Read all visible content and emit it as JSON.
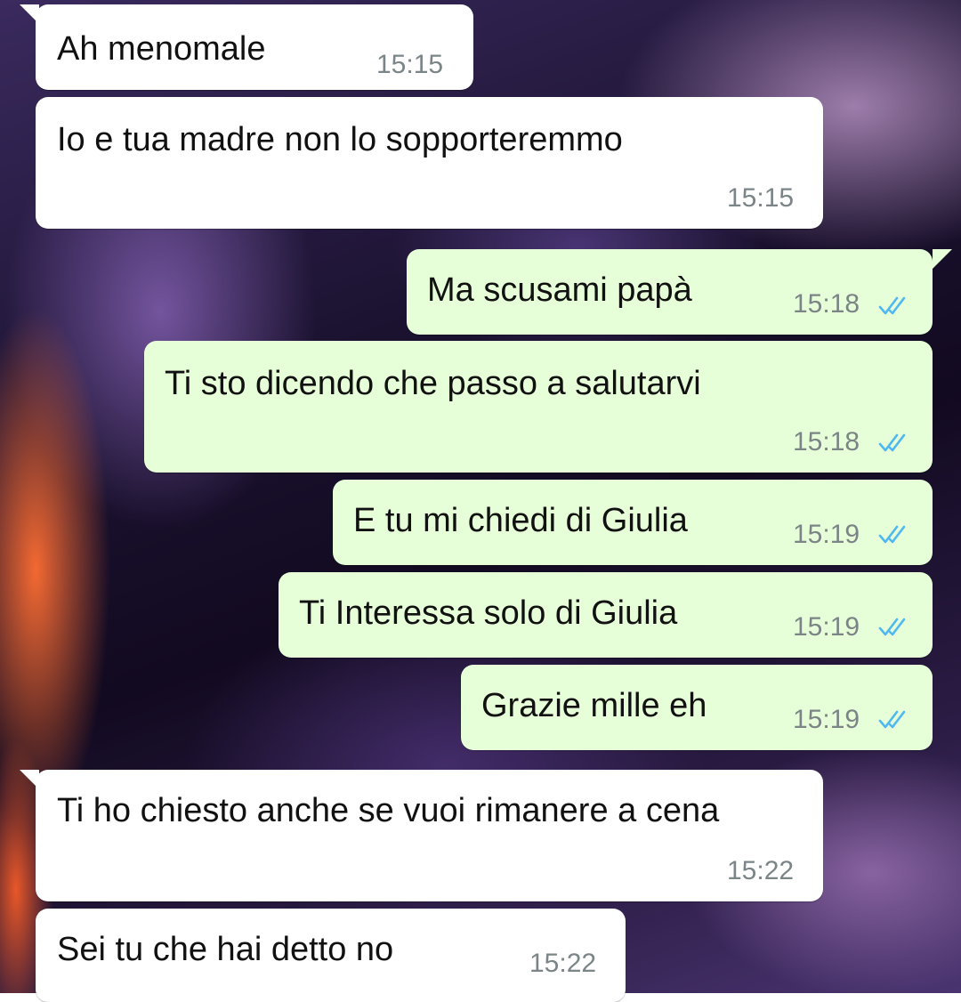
{
  "chat": {
    "messages": [
      {
        "direction": "incoming",
        "text": "Ah menomale",
        "time": "15:15"
      },
      {
        "direction": "incoming",
        "text": "Io e tua madre non lo sopporteremmo",
        "time": "15:15"
      },
      {
        "direction": "outgoing",
        "text": "Ma scusami papà",
        "time": "15:18",
        "status": "read-double-check"
      },
      {
        "direction": "outgoing",
        "text": "Ti sto dicendo che passo a salutarvi",
        "time": "15:18",
        "status": "read-double-check"
      },
      {
        "direction": "outgoing",
        "text": "E tu mi chiedi di Giulia",
        "time": "15:19",
        "status": "read-double-check"
      },
      {
        "direction": "outgoing",
        "text": "Ti Interessa solo di Giulia",
        "time": "15:19",
        "status": "read-double-check"
      },
      {
        "direction": "outgoing",
        "text": "Grazie mille eh",
        "time": "15:19",
        "status": "read-double-check"
      },
      {
        "direction": "incoming",
        "text": "Ti ho chiesto anche se vuoi rimanere a cena",
        "time": "15:22"
      },
      {
        "direction": "incoming",
        "text": "Sei tu che hai detto no",
        "time": "15:22"
      }
    ],
    "colors": {
      "incoming_bubble": "#ffffff",
      "outgoing_bubble": "#e7ffd8",
      "read_tick": "#4fb8f0",
      "timestamp": "#7b8486"
    }
  }
}
